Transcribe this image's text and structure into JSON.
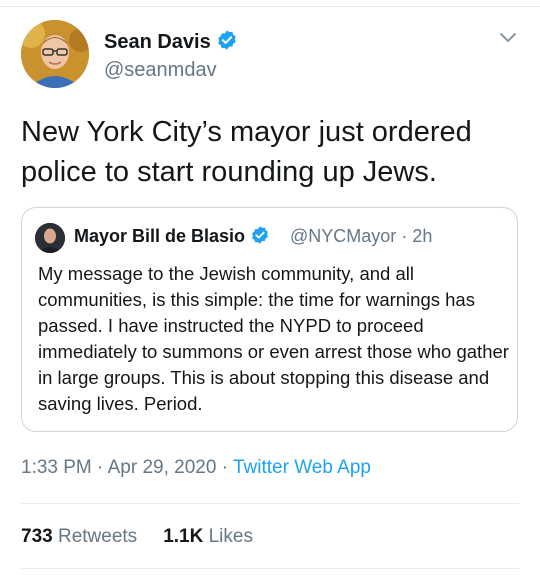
{
  "author": {
    "name": "Sean Davis",
    "handle": "@seanmdav",
    "verified": true
  },
  "tweet_text": "New York City’s mayor just ordered police to start rounding up Jews.",
  "quoted_tweet": {
    "name": "Mayor Bill de Blasio",
    "handle": "@NYCMayor",
    "separator": "·",
    "age": "2h",
    "verified": true,
    "text": "My message to the Jewish community, and all communities, is this simple: the time for warnings has passed. I have instructed the NYPD to proceed immediately to summons or even arrest those who gather in large groups. This is about stopping this disease and saving lives. Period."
  },
  "meta": {
    "time": "1:33 PM",
    "sep1": "·",
    "date": "Apr 29, 2020",
    "sep2": "·",
    "app": "Twitter Web App"
  },
  "stats": {
    "retweets_count": "733",
    "retweets_label": "Retweets",
    "likes_count": "1.1K",
    "likes_label": "Likes"
  },
  "colors": {
    "accent": "#1da1f2",
    "muted": "#657786",
    "text": "#14171a",
    "border": "#ccd6dd"
  },
  "icons": {
    "verified": "verified-badge-icon",
    "more": "chevron-down-icon"
  }
}
